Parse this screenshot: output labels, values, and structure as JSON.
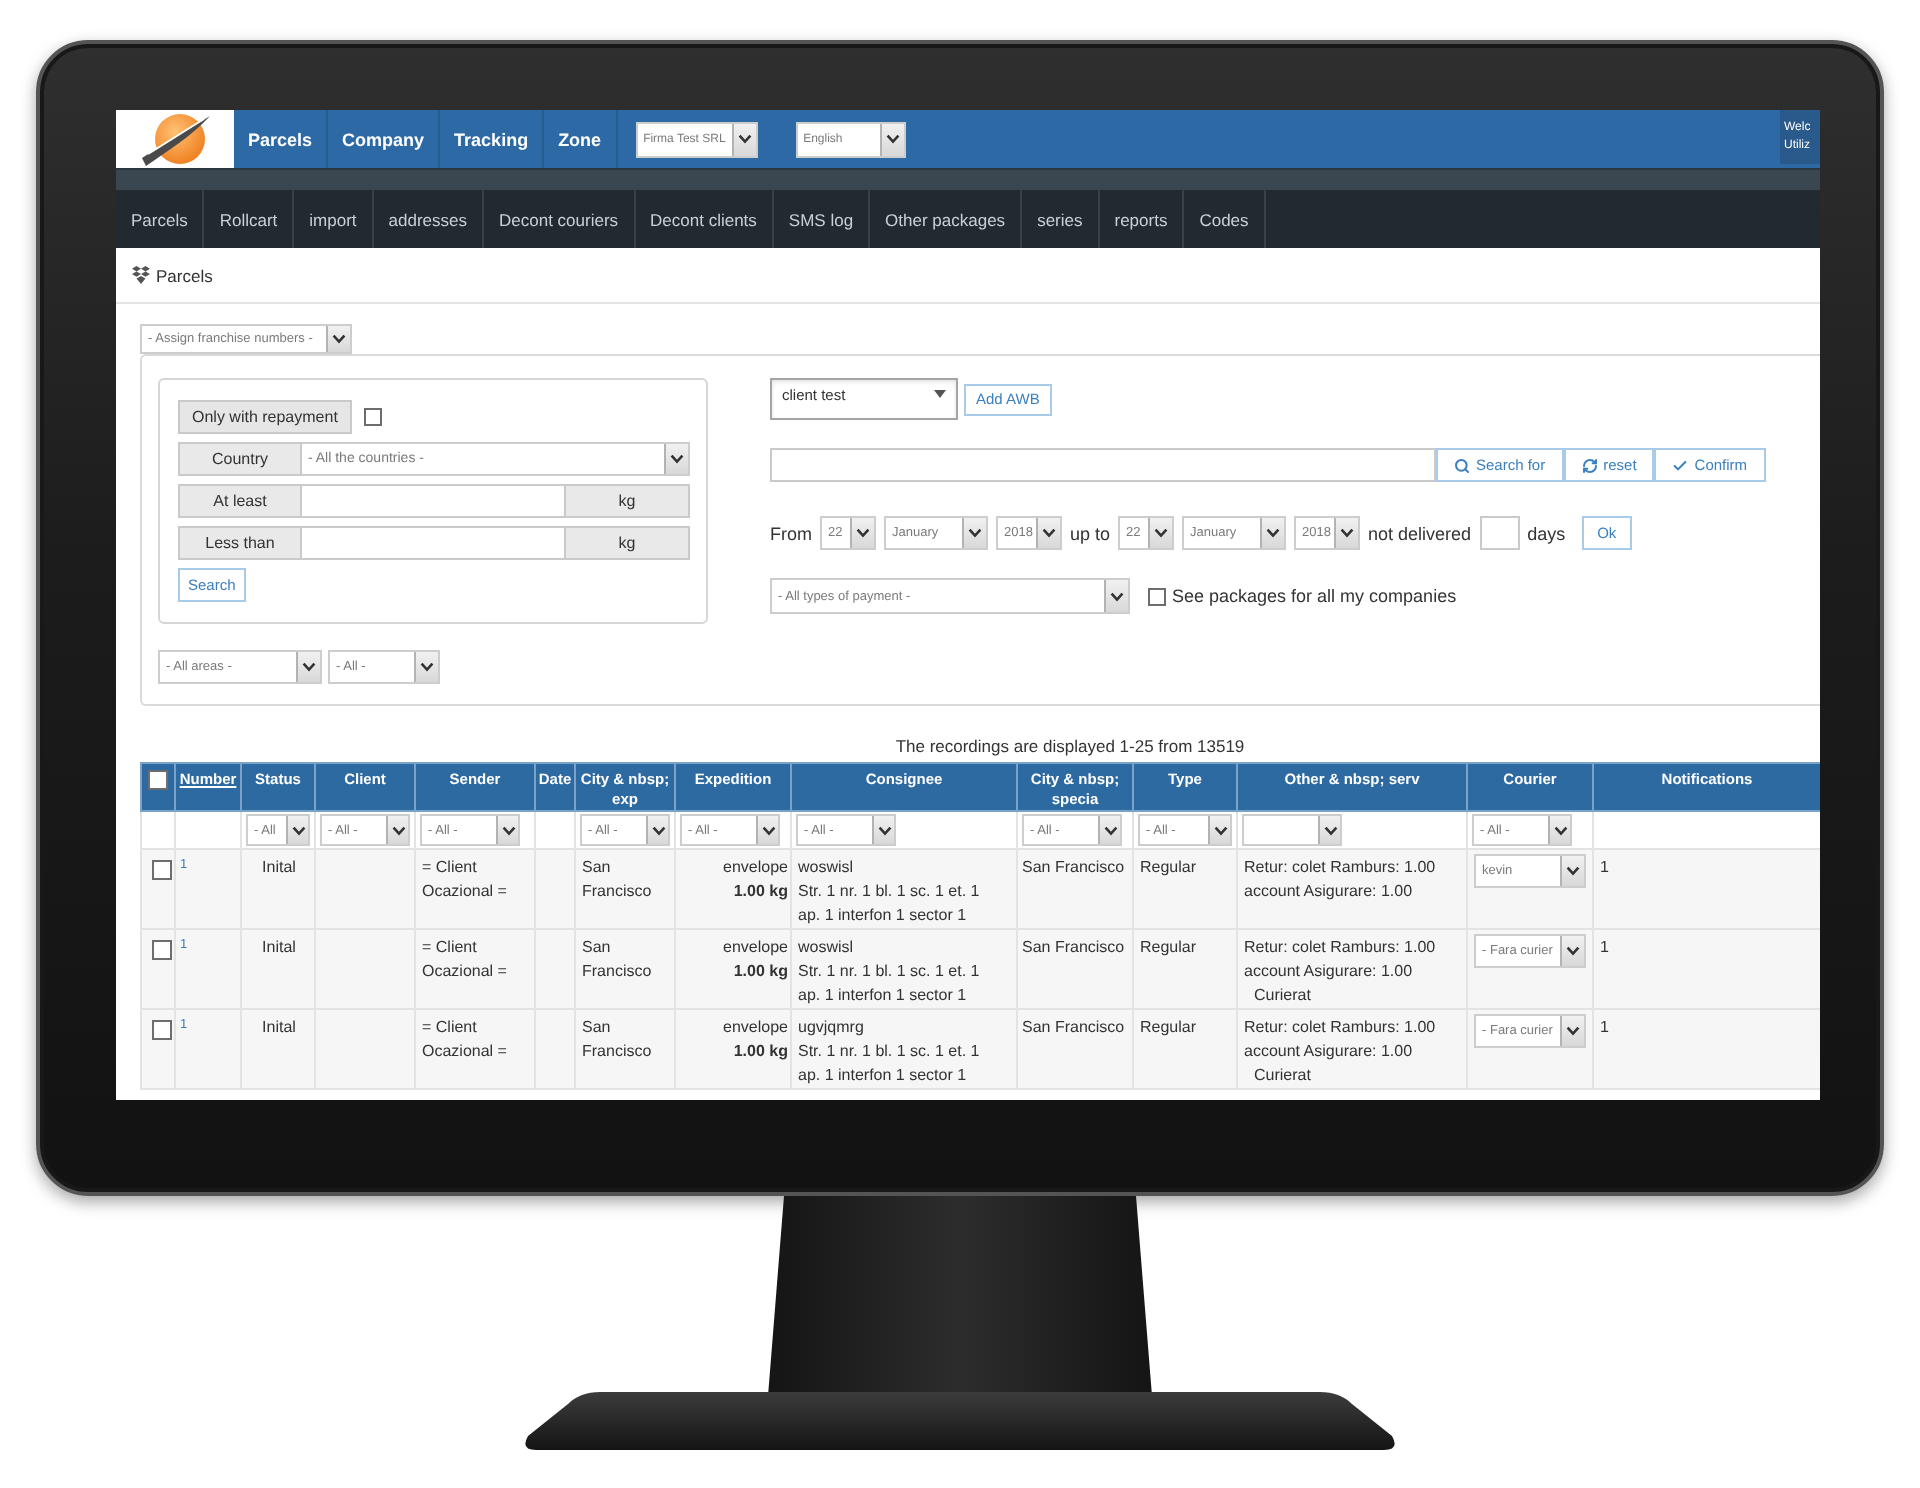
{
  "top_nav": {
    "items": [
      "Parcels",
      "Company",
      "Tracking",
      "Zone"
    ],
    "company_select": "Firma Test SRL",
    "language_select": "English",
    "user_panel": {
      "greeting": "Welc",
      "user": "Utiliz"
    }
  },
  "sub_nav": {
    "items": [
      "Parcels",
      "Rollcart",
      "import",
      "addresses",
      "Decont couriers",
      "Decont clients",
      "SMS log",
      "Other packages",
      "series",
      "reports",
      "Codes"
    ]
  },
  "page_title": "Parcels",
  "franchise_select": "- Assign franchise numbers -",
  "filters": {
    "repayment": {
      "label": "Only with repayment",
      "checked": false
    },
    "country": {
      "label": "Country",
      "value": "- All the countries -"
    },
    "min_weight": {
      "label": "At least",
      "unit": "kg"
    },
    "max_weight": {
      "label": "Less than",
      "unit": "kg"
    },
    "search_button": "Search",
    "area_select": "- All areas -",
    "subarea_select": "- All -"
  },
  "search": {
    "client_select": "client test",
    "add_button": "Add AWB",
    "actions": [
      {
        "kind": "search",
        "label": "Search for"
      },
      {
        "kind": "reset",
        "label": "reset"
      },
      {
        "kind": "confirm",
        "label": "Confirm"
      }
    ],
    "date_range": {
      "from_label": "From",
      "from": {
        "day": "22",
        "month": "January",
        "year": "2018"
      },
      "to_label": "up to",
      "to": {
        "day": "22",
        "month": "January",
        "year": "2018"
      },
      "not_delivered_label": "not delivered",
      "days_label": "days",
      "ok_button": "Ok"
    },
    "payment_select": "- All types of payment -",
    "all_companies": {
      "label": "See packages for all my companies",
      "checked": false
    }
  },
  "summary": "The recordings are displayed 1-25 from 13519",
  "table": {
    "select_all": {
      "checked": false
    },
    "columns": [
      {
        "label": "Number",
        "kind": "link",
        "filter": false
      },
      {
        "label": "Status",
        "kind": "text",
        "filter": true,
        "filter_value": "- All"
      },
      {
        "label": "Client",
        "kind": "text",
        "filter": true,
        "filter_value": "- All -"
      },
      {
        "label": "Sender",
        "kind": "text",
        "filter": true,
        "filter_value": "- All -"
      },
      {
        "label": "Date",
        "kind": "text",
        "filter": false
      },
      {
        "label": "City & nbsp; exp",
        "kind": "text",
        "filter": true,
        "filter_value": "- All -"
      },
      {
        "label": "Expedition",
        "kind": "text",
        "filter": true,
        "filter_value": "- All -"
      },
      {
        "label": "Consignee",
        "kind": "text",
        "filter": true,
        "filter_value": "- All -"
      },
      {
        "label": "City & nbsp; specia",
        "kind": "text",
        "filter": true,
        "filter_value": "- All -"
      },
      {
        "label": "Type",
        "kind": "text",
        "filter": true,
        "filter_value": "- All -"
      },
      {
        "label": "Other & nbsp; serv",
        "kind": "text",
        "filter": true
      },
      {
        "label": "Courier",
        "kind": "text",
        "filter": true,
        "filter_value": "- All -"
      },
      {
        "label": "Notifications",
        "kind": "text",
        "filter": false
      }
    ],
    "rows": [
      {
        "checked": false,
        "number": "1",
        "status": "Inital",
        "sender": "= Client Ocazional =",
        "city_exp": "San Francisco",
        "package_type": "envelope",
        "weight": "1.00 kg",
        "consignee_name": "woswisl",
        "consignee_address": "Str. 1 nr. 1 bl. 1 sc. 1 et. 1 ap. 1 interfon 1 sector 1",
        "city_specia": "San Francisco",
        "type": "Regular",
        "services": "Retur: colet Ramburs: 1.00 account Asigurare: 1.00",
        "courier": "kevin",
        "notifications": "1"
      },
      {
        "checked": false,
        "number": "1",
        "status": "Inital",
        "sender": "= Client Ocazional =",
        "city_exp": "San Francisco",
        "package_type": "envelope",
        "weight": "1.00 kg",
        "consignee_name": "woswisl",
        "consignee_address": "Str. 1 nr. 1 bl. 1 sc. 1 et. 1 ap. 1 interfon 1 sector 1",
        "city_specia": "San Francisco",
        "type": "Regular",
        "services": "Retur: colet Ramburs: 1.00 account Asigurare: 1.00",
        "services_note": "Curierat",
        "courier": "- Fara curier",
        "notifications": "1"
      },
      {
        "checked": false,
        "number": "1",
        "status": "Inital",
        "sender": "= Client Ocazional =",
        "city_exp": "San Francisco",
        "package_type": "envelope",
        "weight": "1.00 kg",
        "consignee_name": "ugvjqmrg",
        "consignee_address": "Str. 1 nr. 1 bl. 1 sc. 1 et. 1 ap. 1 interfon 1 sector 1",
        "city_specia": "San Francisco",
        "type": "Regular",
        "services": "Retur: colet Ramburs: 1.00 account Asigurare: 1.00",
        "services_note": "Curierat",
        "courier": "- Fara curier",
        "notifications": "1"
      }
    ]
  }
}
